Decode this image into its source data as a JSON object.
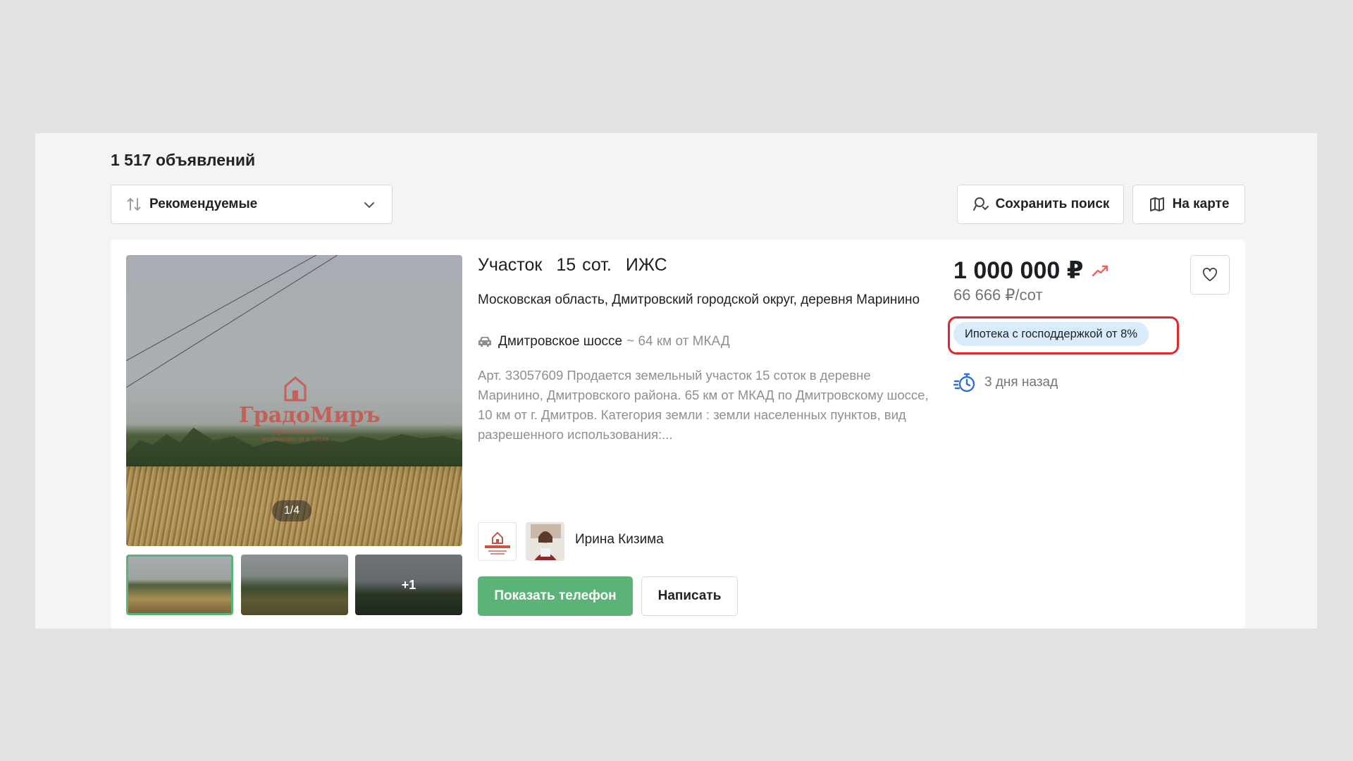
{
  "listing_count": "1 517 объявлений",
  "sort": {
    "label": "Рекомендуемые"
  },
  "toolbar": {
    "save_search_label": "Сохранить поиск",
    "map_label": "На карте"
  },
  "card": {
    "photo_counter": "1/4",
    "more_photos": "+1",
    "watermark": {
      "brand": "ГрадоМиръ",
      "tagline_1": "Русский центр",
      "tagline_2": "недвижимости и права"
    },
    "title_parts": [
      "Участок",
      "15 сот.",
      "ИЖС"
    ],
    "address": "Московская область, Дмитровский городской округ, деревня Маринино",
    "road": {
      "name": "Дмитровское шоссе",
      "distance": "~ 64 км от МКАД"
    },
    "description": "Арт. 33057609 Продается земельный участок 15 соток в деревне Маринино, Дмитровского района. 65 км от МКАД по Дмитровскому шоссе, 10 км от г. Дмитров. Категория земли : земли населенных пунктов, вид разрешенного использования:...",
    "agent_name": "Ирина Кизима",
    "show_phone_label": "Показать телефон",
    "write_label": "Написать",
    "price": "1 000 000 ₽",
    "price_per_unit": "66 666 ₽/сот",
    "mortgage_badge": "Ипотека с господдержкой от 8%",
    "posted": "3 дня назад"
  },
  "colors": {
    "accent_green": "#5cb377",
    "highlight_red": "#e3262b",
    "badge_blue": "#d8ecfb",
    "trend_red": "#f0625a",
    "date_icon_blue": "#2f6fdc"
  },
  "icons": [
    "sort-icon",
    "chevron-down-icon",
    "search-save-icon",
    "map-icon",
    "car-icon",
    "trend-up-icon",
    "heart-icon",
    "clock-speed-icon"
  ]
}
